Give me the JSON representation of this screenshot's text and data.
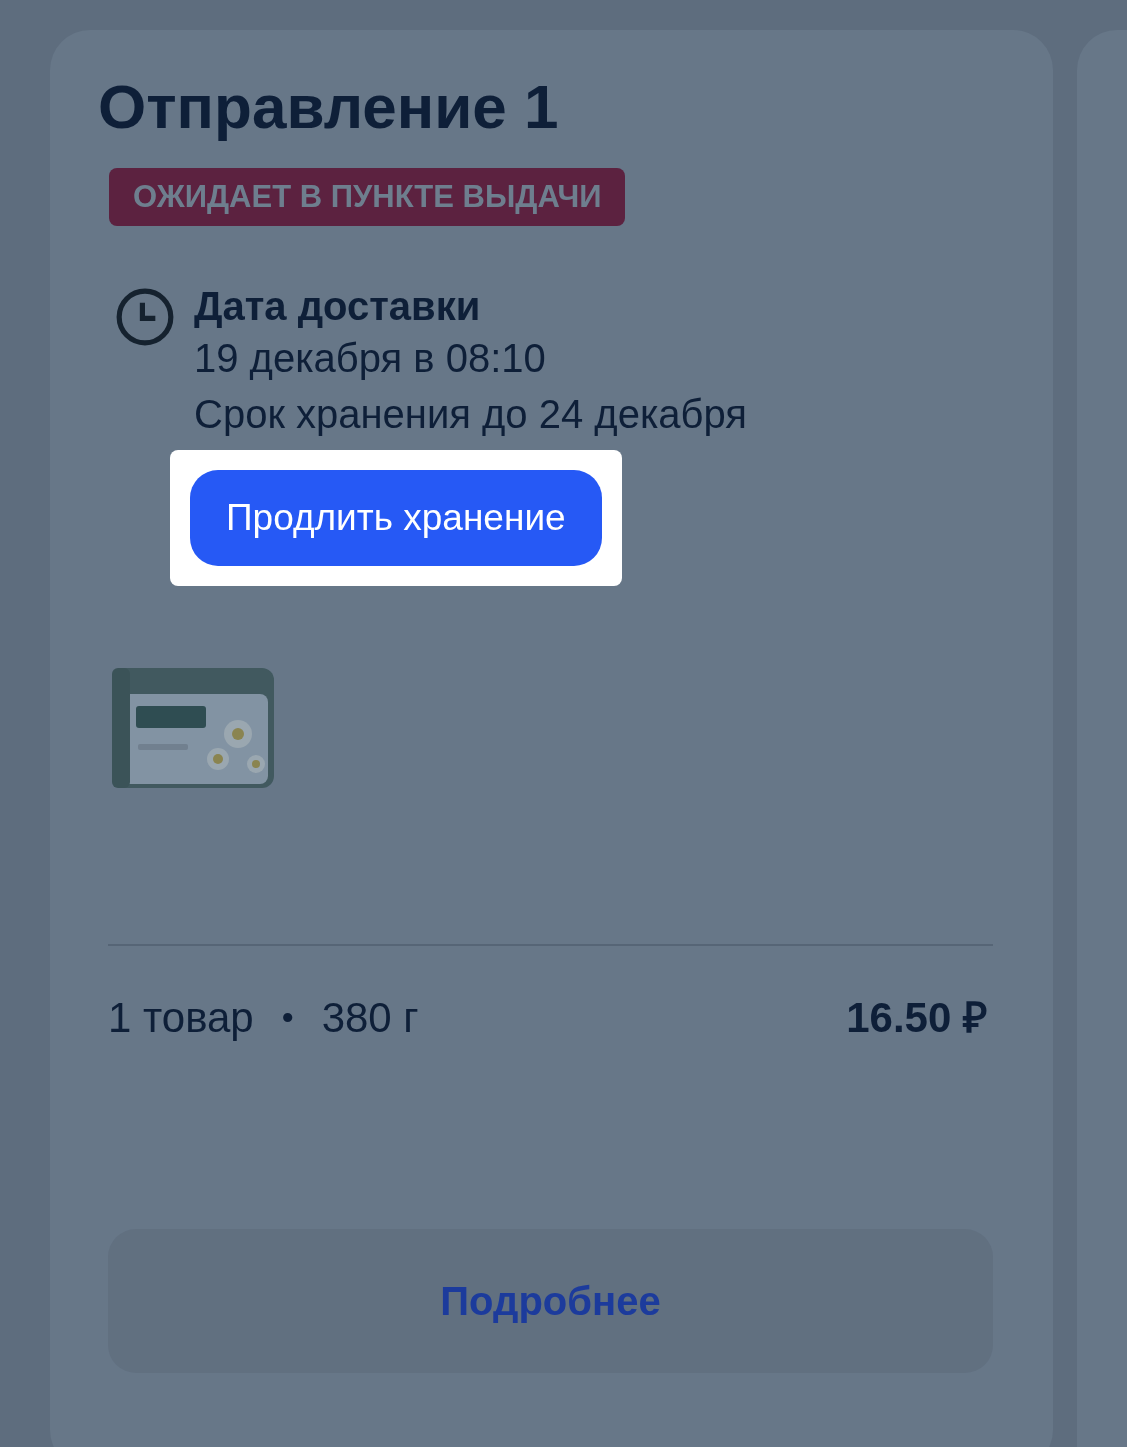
{
  "shipment": {
    "title": "Отправление 1",
    "status": "ОЖИДАЕТ В ПУНКТЕ ВЫДАЧИ",
    "delivery_label": "Дата доставки",
    "delivery_date": "19 декабря в 08:10",
    "storage_until": "Срок хранения до 24 декабря",
    "extend_button": "Продлить хранение",
    "count": "1 товар",
    "separator": "•",
    "weight": "380 г",
    "price": "16.50 ₽",
    "details_button": "Подробнее"
  }
}
